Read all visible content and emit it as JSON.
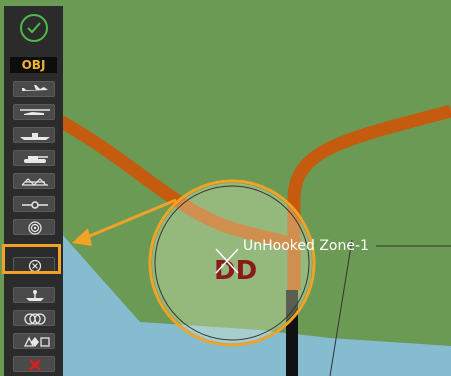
{
  "toolbar": {
    "confirm_icon": "check-circle-icon",
    "obj_label": "OBJ",
    "tools": [
      {
        "name": "aircraft-icon"
      },
      {
        "name": "helicopter-icon"
      },
      {
        "name": "ship-icon"
      },
      {
        "name": "tank-icon"
      },
      {
        "name": "bridge-icon"
      },
      {
        "name": "waypoint-icon"
      },
      {
        "name": "target-icon"
      },
      {
        "name": "circle-x-icon",
        "selected": true
      },
      {
        "name": "anchor-icon"
      },
      {
        "name": "rings-icon"
      },
      {
        "name": "shapes-icon"
      },
      {
        "name": "delete-icon"
      }
    ]
  },
  "map": {
    "zone_label": "UnHooked Zone-1",
    "zone_symbol": "DD",
    "colors": {
      "land": "#6b9a55",
      "water": "#86bcd0",
      "road": "#c55b0e",
      "highlight": "#f0a326",
      "symbol": "#8b1a1a",
      "toolbar": "#2b2b2b"
    }
  }
}
